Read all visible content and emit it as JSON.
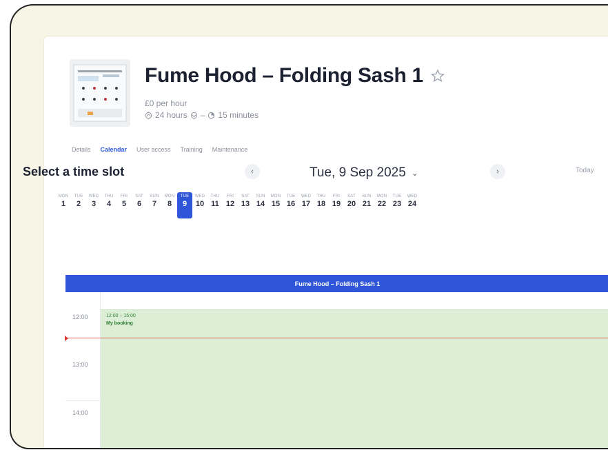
{
  "header": {
    "title": "Fume Hood – Folding Sash 1",
    "price": "£0 per hour",
    "duration_max": "24 hours",
    "duration_separator": "–",
    "duration_min": "15 minutes"
  },
  "tabs": [
    {
      "label": "Details",
      "active": false
    },
    {
      "label": "Calendar",
      "active": true
    },
    {
      "label": "User access",
      "active": false
    },
    {
      "label": "Training",
      "active": false
    },
    {
      "label": "Maintenance",
      "active": false
    }
  ],
  "calendar": {
    "section_title": "Select a time slot",
    "prev_label": "‹",
    "next_label": "›",
    "current_date": "Tue, 9 Sep 2025",
    "dropdown_label": "⌄",
    "today_label": "Today",
    "days": [
      {
        "dow": "MON",
        "num": "1"
      },
      {
        "dow": "TUE",
        "num": "2"
      },
      {
        "dow": "WED",
        "num": "3"
      },
      {
        "dow": "THU",
        "num": "4"
      },
      {
        "dow": "FRI",
        "num": "5"
      },
      {
        "dow": "SAT",
        "num": "6"
      },
      {
        "dow": "SUN",
        "num": "7"
      },
      {
        "dow": "MON",
        "num": "8"
      },
      {
        "dow": "TUE",
        "num": "9"
      },
      {
        "dow": "WED",
        "num": "10"
      },
      {
        "dow": "THU",
        "num": "11"
      },
      {
        "dow": "FRI",
        "num": "12"
      },
      {
        "dow": "SAT",
        "num": "13"
      },
      {
        "dow": "SUN",
        "num": "14"
      },
      {
        "dow": "MON",
        "num": "15"
      },
      {
        "dow": "TUE",
        "num": "16"
      },
      {
        "dow": "WED",
        "num": "17"
      },
      {
        "dow": "THU",
        "num": "18"
      },
      {
        "dow": "FRI",
        "num": "19"
      },
      {
        "dow": "SAT",
        "num": "20"
      },
      {
        "dow": "SUN",
        "num": "21"
      },
      {
        "dow": "MON",
        "num": "22"
      },
      {
        "dow": "TUE",
        "num": "23"
      },
      {
        "dow": "WED",
        "num": "24"
      }
    ],
    "selected_day": "9",
    "resource_header": "Fume Hood – Folding Sash 1",
    "times": [
      "12:00",
      "13:00",
      "14:00"
    ],
    "booking": {
      "time": "12:00 – 15:00",
      "label": "My booking"
    }
  },
  "colors": {
    "accent": "#2f56d8",
    "booking_bg": "#dcefd6",
    "booking_text": "#2e7d32",
    "now_line": "#e35b5b",
    "frame_bg": "#f7f6e6"
  }
}
